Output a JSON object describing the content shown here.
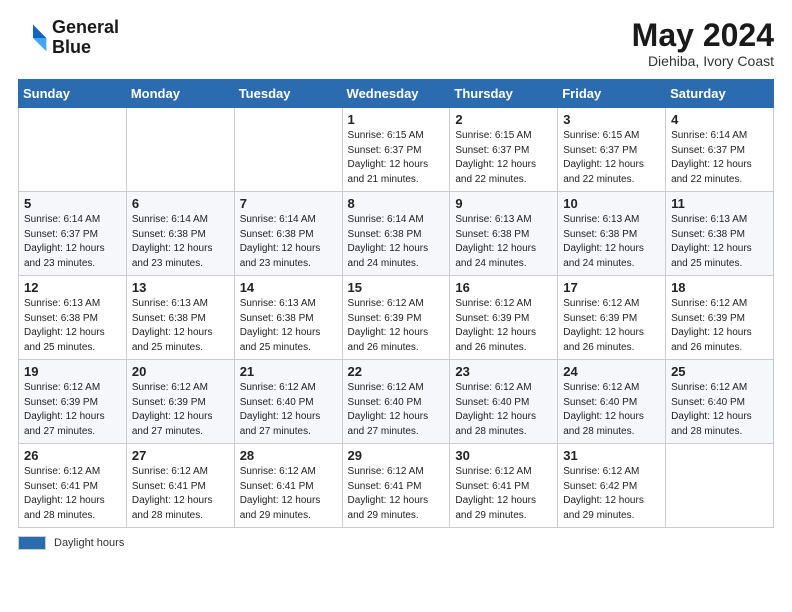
{
  "header": {
    "logo_line1": "General",
    "logo_line2": "Blue",
    "month_year": "May 2024",
    "location": "Diehiba, Ivory Coast"
  },
  "weekdays": [
    "Sunday",
    "Monday",
    "Tuesday",
    "Wednesday",
    "Thursday",
    "Friday",
    "Saturday"
  ],
  "weeks": [
    [
      {
        "day": "",
        "info": ""
      },
      {
        "day": "",
        "info": ""
      },
      {
        "day": "",
        "info": ""
      },
      {
        "day": "1",
        "info": "Sunrise: 6:15 AM\nSunset: 6:37 PM\nDaylight: 12 hours\nand 21 minutes."
      },
      {
        "day": "2",
        "info": "Sunrise: 6:15 AM\nSunset: 6:37 PM\nDaylight: 12 hours\nand 22 minutes."
      },
      {
        "day": "3",
        "info": "Sunrise: 6:15 AM\nSunset: 6:37 PM\nDaylight: 12 hours\nand 22 minutes."
      },
      {
        "day": "4",
        "info": "Sunrise: 6:14 AM\nSunset: 6:37 PM\nDaylight: 12 hours\nand 22 minutes."
      }
    ],
    [
      {
        "day": "5",
        "info": "Sunrise: 6:14 AM\nSunset: 6:37 PM\nDaylight: 12 hours\nand 23 minutes."
      },
      {
        "day": "6",
        "info": "Sunrise: 6:14 AM\nSunset: 6:38 PM\nDaylight: 12 hours\nand 23 minutes."
      },
      {
        "day": "7",
        "info": "Sunrise: 6:14 AM\nSunset: 6:38 PM\nDaylight: 12 hours\nand 23 minutes."
      },
      {
        "day": "8",
        "info": "Sunrise: 6:14 AM\nSunset: 6:38 PM\nDaylight: 12 hours\nand 24 minutes."
      },
      {
        "day": "9",
        "info": "Sunrise: 6:13 AM\nSunset: 6:38 PM\nDaylight: 12 hours\nand 24 minutes."
      },
      {
        "day": "10",
        "info": "Sunrise: 6:13 AM\nSunset: 6:38 PM\nDaylight: 12 hours\nand 24 minutes."
      },
      {
        "day": "11",
        "info": "Sunrise: 6:13 AM\nSunset: 6:38 PM\nDaylight: 12 hours\nand 25 minutes."
      }
    ],
    [
      {
        "day": "12",
        "info": "Sunrise: 6:13 AM\nSunset: 6:38 PM\nDaylight: 12 hours\nand 25 minutes."
      },
      {
        "day": "13",
        "info": "Sunrise: 6:13 AM\nSunset: 6:38 PM\nDaylight: 12 hours\nand 25 minutes."
      },
      {
        "day": "14",
        "info": "Sunrise: 6:13 AM\nSunset: 6:38 PM\nDaylight: 12 hours\nand 25 minutes."
      },
      {
        "day": "15",
        "info": "Sunrise: 6:12 AM\nSunset: 6:39 PM\nDaylight: 12 hours\nand 26 minutes."
      },
      {
        "day": "16",
        "info": "Sunrise: 6:12 AM\nSunset: 6:39 PM\nDaylight: 12 hours\nand 26 minutes."
      },
      {
        "day": "17",
        "info": "Sunrise: 6:12 AM\nSunset: 6:39 PM\nDaylight: 12 hours\nand 26 minutes."
      },
      {
        "day": "18",
        "info": "Sunrise: 6:12 AM\nSunset: 6:39 PM\nDaylight: 12 hours\nand 26 minutes."
      }
    ],
    [
      {
        "day": "19",
        "info": "Sunrise: 6:12 AM\nSunset: 6:39 PM\nDaylight: 12 hours\nand 27 minutes."
      },
      {
        "day": "20",
        "info": "Sunrise: 6:12 AM\nSunset: 6:39 PM\nDaylight: 12 hours\nand 27 minutes."
      },
      {
        "day": "21",
        "info": "Sunrise: 6:12 AM\nSunset: 6:40 PM\nDaylight: 12 hours\nand 27 minutes."
      },
      {
        "day": "22",
        "info": "Sunrise: 6:12 AM\nSunset: 6:40 PM\nDaylight: 12 hours\nand 27 minutes."
      },
      {
        "day": "23",
        "info": "Sunrise: 6:12 AM\nSunset: 6:40 PM\nDaylight: 12 hours\nand 28 minutes."
      },
      {
        "day": "24",
        "info": "Sunrise: 6:12 AM\nSunset: 6:40 PM\nDaylight: 12 hours\nand 28 minutes."
      },
      {
        "day": "25",
        "info": "Sunrise: 6:12 AM\nSunset: 6:40 PM\nDaylight: 12 hours\nand 28 minutes."
      }
    ],
    [
      {
        "day": "26",
        "info": "Sunrise: 6:12 AM\nSunset: 6:41 PM\nDaylight: 12 hours\nand 28 minutes."
      },
      {
        "day": "27",
        "info": "Sunrise: 6:12 AM\nSunset: 6:41 PM\nDaylight: 12 hours\nand 28 minutes."
      },
      {
        "day": "28",
        "info": "Sunrise: 6:12 AM\nSunset: 6:41 PM\nDaylight: 12 hours\nand 29 minutes."
      },
      {
        "day": "29",
        "info": "Sunrise: 6:12 AM\nSunset: 6:41 PM\nDaylight: 12 hours\nand 29 minutes."
      },
      {
        "day": "30",
        "info": "Sunrise: 6:12 AM\nSunset: 6:41 PM\nDaylight: 12 hours\nand 29 minutes."
      },
      {
        "day": "31",
        "info": "Sunrise: 6:12 AM\nSunset: 6:42 PM\nDaylight: 12 hours\nand 29 minutes."
      },
      {
        "day": "",
        "info": ""
      }
    ]
  ],
  "footer": {
    "legend_label": "Daylight hours"
  },
  "colors": {
    "header_bg": "#2b6cb0",
    "logo_blue": "#1565c0"
  }
}
